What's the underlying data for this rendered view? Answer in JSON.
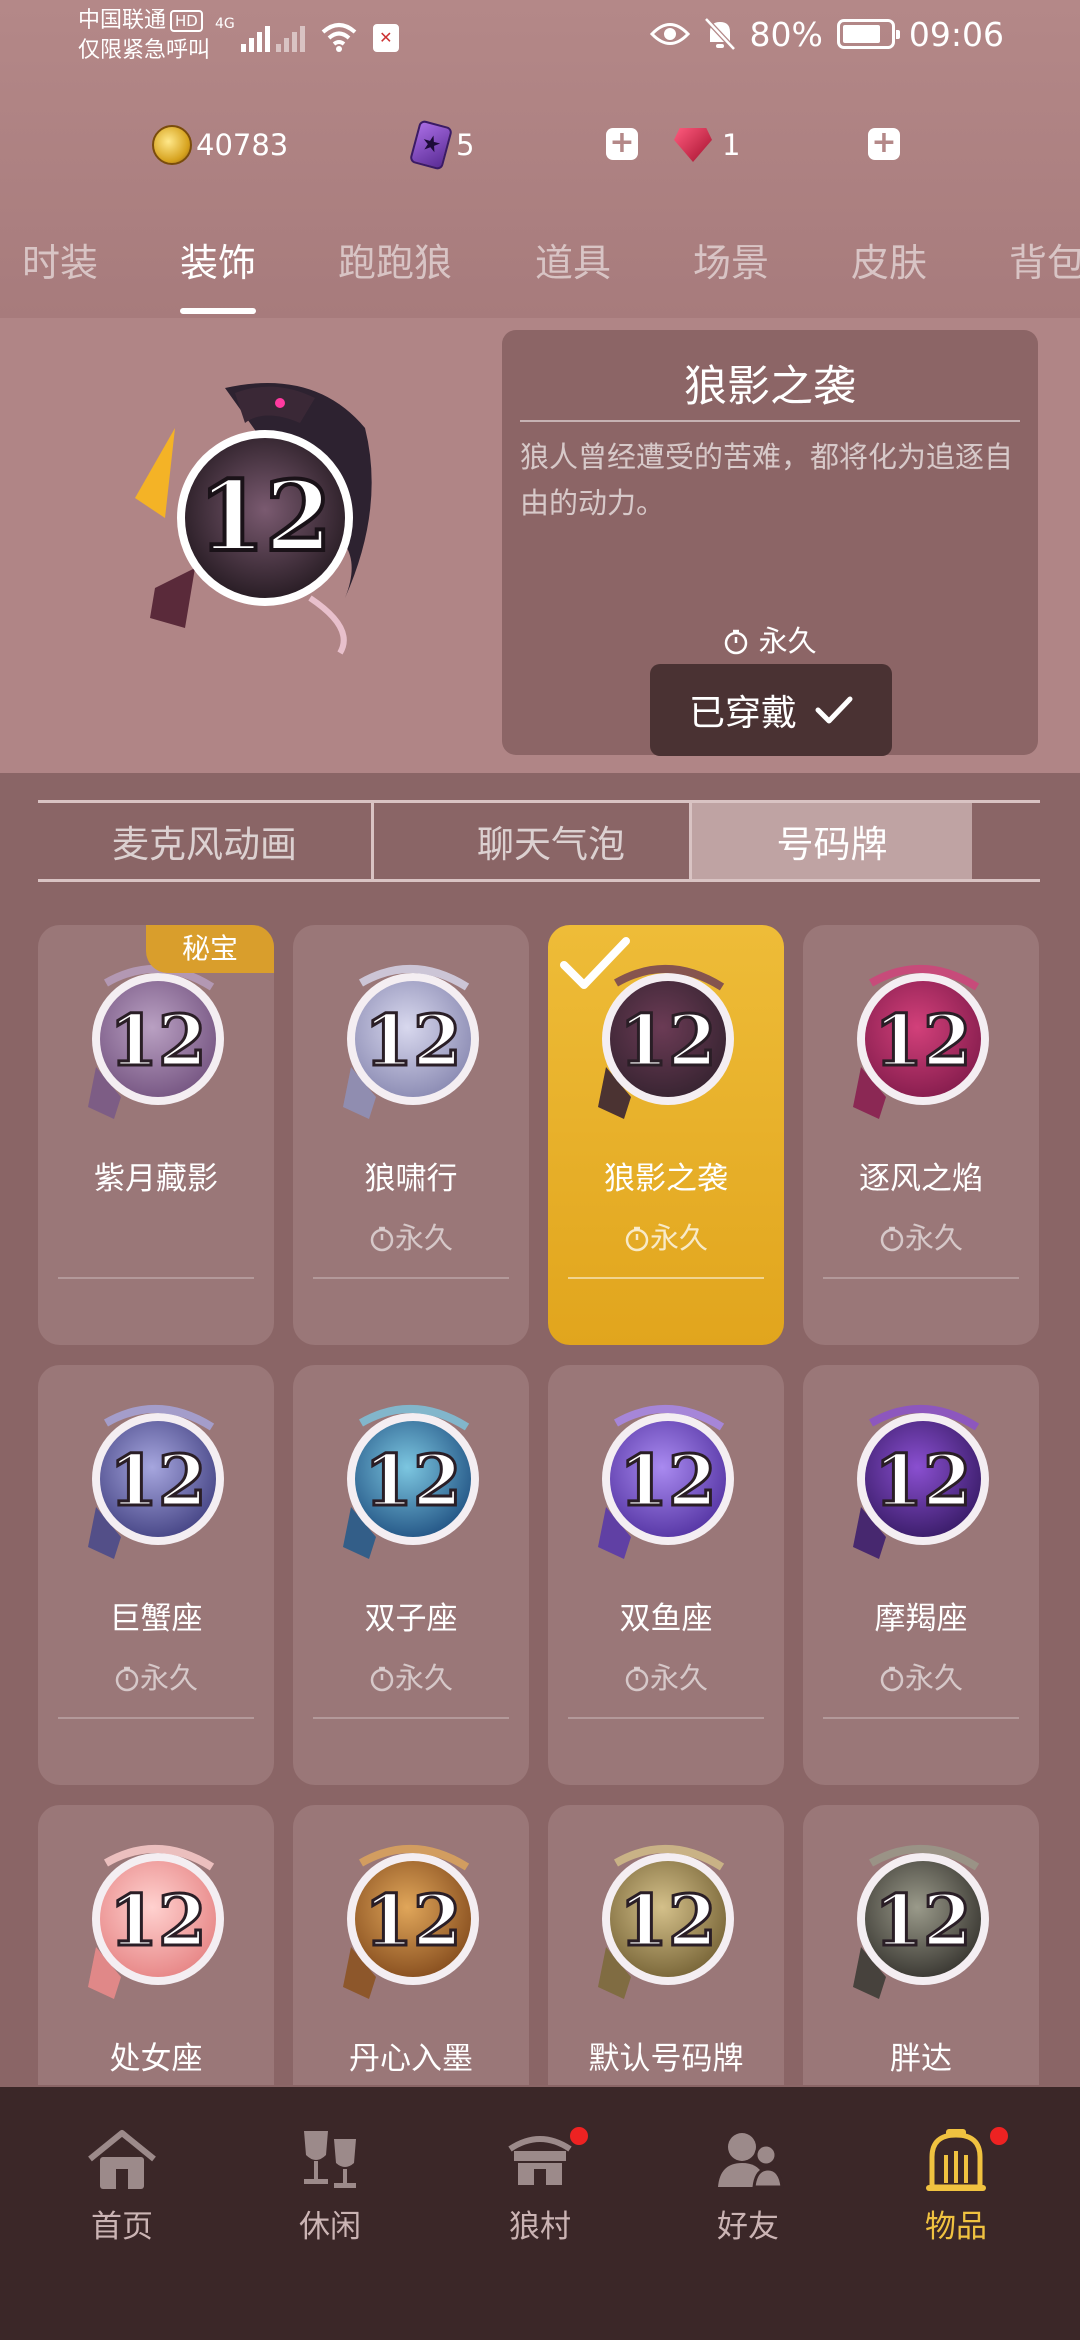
{
  "status_bar": {
    "carrier_line1": "中国联通",
    "hd": "HD",
    "carrier_line2": "仅限紧急呼叫",
    "network": "4G",
    "battery": "80%",
    "time": "09:06"
  },
  "currency": {
    "coins": "40783",
    "cards": "5",
    "gems": "1",
    "card_glyph": "★"
  },
  "category_tabs": [
    "时装",
    "装饰",
    "跑跑狼",
    "道具",
    "场景",
    "皮肤",
    "背包"
  ],
  "active_category": "装饰",
  "preview": {
    "title": "狼影之袭",
    "description": "狼人曾经遭受的苦难，都将化为追逐自由的动力。",
    "duration": "永久",
    "worn_label": "已穿戴"
  },
  "badge_number": "12",
  "sub_tabs": [
    "麦克风动画",
    "聊天气泡",
    "号码牌"
  ],
  "active_sub_tab": "号码牌",
  "items": [
    {
      "name": "紫月藏影",
      "duration": "",
      "tag": "秘宝",
      "colors": [
        "#7a5a86",
        "#b9a0c2"
      ]
    },
    {
      "name": "狼啸行",
      "duration": "永久",
      "colors": [
        "#8f8fb6",
        "#d8d8ee"
      ]
    },
    {
      "name": "狼影之袭",
      "duration": "永久",
      "selected": true,
      "colors": [
        "#3a2533",
        "#6b3b55"
      ]
    },
    {
      "name": "逐风之焰",
      "duration": "永久",
      "colors": [
        "#8a1f50",
        "#d2407a"
      ]
    },
    {
      "name": "巨蟹座",
      "duration": "永久",
      "colors": [
        "#4b4a8a",
        "#a6a6de"
      ]
    },
    {
      "name": "双子座",
      "duration": "永久",
      "colors": [
        "#285b8a",
        "#7cc6e0"
      ]
    },
    {
      "name": "双鱼座",
      "duration": "永久",
      "colors": [
        "#5a3aa8",
        "#a98af0"
      ]
    },
    {
      "name": "摩羯座",
      "duration": "永久",
      "colors": [
        "#3e1f6e",
        "#8a4fd0"
      ]
    },
    {
      "name": "处女座",
      "duration": "",
      "colors": [
        "#e88a8a",
        "#ffd1cf"
      ]
    },
    {
      "name": "丹心入墨",
      "duration": "",
      "colors": [
        "#8c5322",
        "#e0a65a"
      ]
    },
    {
      "name": "默认号码牌",
      "duration": "",
      "colors": [
        "#7d6a3c",
        "#d4c08a"
      ]
    },
    {
      "name": "胖达",
      "duration": "",
      "colors": [
        "#3e3c36",
        "#9a9a8a"
      ]
    }
  ],
  "bottom_nav": [
    {
      "label": "首页",
      "icon": "home-icon"
    },
    {
      "label": "休闲",
      "icon": "leisure-icon"
    },
    {
      "label": "狼村",
      "icon": "village-icon",
      "dot": true
    },
    {
      "label": "好友",
      "icon": "friends-icon"
    },
    {
      "label": "物品",
      "icon": "items-icon",
      "dot": true,
      "active": true
    }
  ],
  "colors": {
    "accent": "#f0c240",
    "selected_card": "#eebc38",
    "card_bg": "#9a7778",
    "nav_bg": "#3b2728"
  }
}
